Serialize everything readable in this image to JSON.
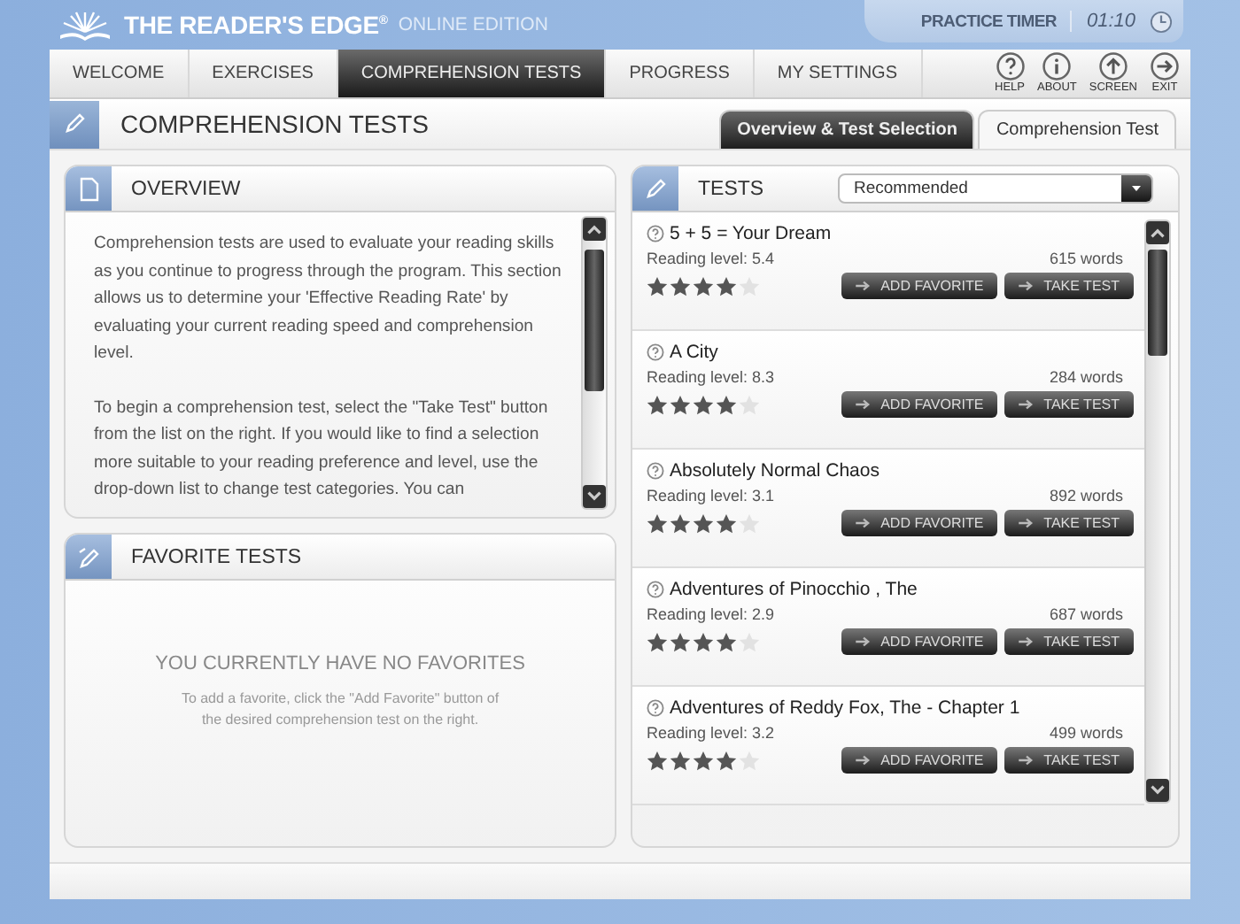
{
  "app": {
    "title": "THE READER'S EDGE",
    "title_mark": "®",
    "edition": "ONLINE EDITION"
  },
  "timer": {
    "label": "PRACTICE TIMER",
    "time": "01:10"
  },
  "nav": [
    {
      "label": "WELCOME",
      "selected": false
    },
    {
      "label": "EXERCISES",
      "selected": false
    },
    {
      "label": "COMPREHENSION TESTS",
      "selected": true
    },
    {
      "label": "PROGRESS",
      "selected": false
    },
    {
      "label": "MY SETTINGS",
      "selected": false
    }
  ],
  "tools": [
    {
      "kind": "help",
      "label": "HELP"
    },
    {
      "kind": "about",
      "label": "ABOUT"
    },
    {
      "kind": "screen",
      "label": "SCREEN"
    },
    {
      "kind": "exit",
      "label": "EXIT"
    }
  ],
  "section": {
    "title": "COMPREHENSION TESTS",
    "tabs": [
      {
        "label": "Overview & Test Selection",
        "selected": true
      },
      {
        "label": "Comprehension Test",
        "selected": false
      }
    ]
  },
  "overview": {
    "title": "OVERVIEW",
    "paragraphs": [
      "Comprehension tests are used to evaluate your reading skills as you continue to progress through the program. This section allows us to determine your 'Effective Reading Rate' by evaluating your current reading speed and comprehension level.",
      "To begin a comprehension test, select the \"Take Test\" button from the list on the right. If you would like to find a selection more suitable to your reading preference and level, use the drop-down list to change test categories. You can"
    ]
  },
  "favorites": {
    "title": "FAVORITE TESTS",
    "empty_title": "YOU CURRENTLY HAVE NO FAVORITES",
    "empty_text": "To add a favorite, click the \"Add Favorite\"  button of the desired comprehension test on the right."
  },
  "tests": {
    "title": "TESTS",
    "filter": "Recommended",
    "items": [
      {
        "title": "5 + 5 = Your Dream",
        "level": "Reading level: 5.4",
        "words": "615 words",
        "stars": 4,
        "add_label": "ADD FAVORITE",
        "take_label": "TAKE TEST"
      },
      {
        "title": "A City",
        "level": "Reading level: 8.3",
        "words": "284 words",
        "stars": 4,
        "add_label": "ADD FAVORITE",
        "take_label": "TAKE TEST"
      },
      {
        "title": "Absolutely Normal Chaos",
        "level": "Reading level: 3.1",
        "words": "892 words",
        "stars": 4,
        "add_label": "ADD FAVORITE",
        "take_label": "TAKE TEST"
      },
      {
        "title": "Adventures of Pinocchio , The",
        "level": "Reading level: 2.9",
        "words": "687 words",
        "stars": 4,
        "add_label": "ADD FAVORITE",
        "take_label": "TAKE TEST"
      },
      {
        "title": "Adventures of Reddy Fox, The - Chapter 1",
        "level": "Reading level: 3.2",
        "words": "499 words",
        "stars": 4,
        "add_label": "ADD FAVORITE",
        "take_label": "TAKE TEST"
      }
    ]
  }
}
